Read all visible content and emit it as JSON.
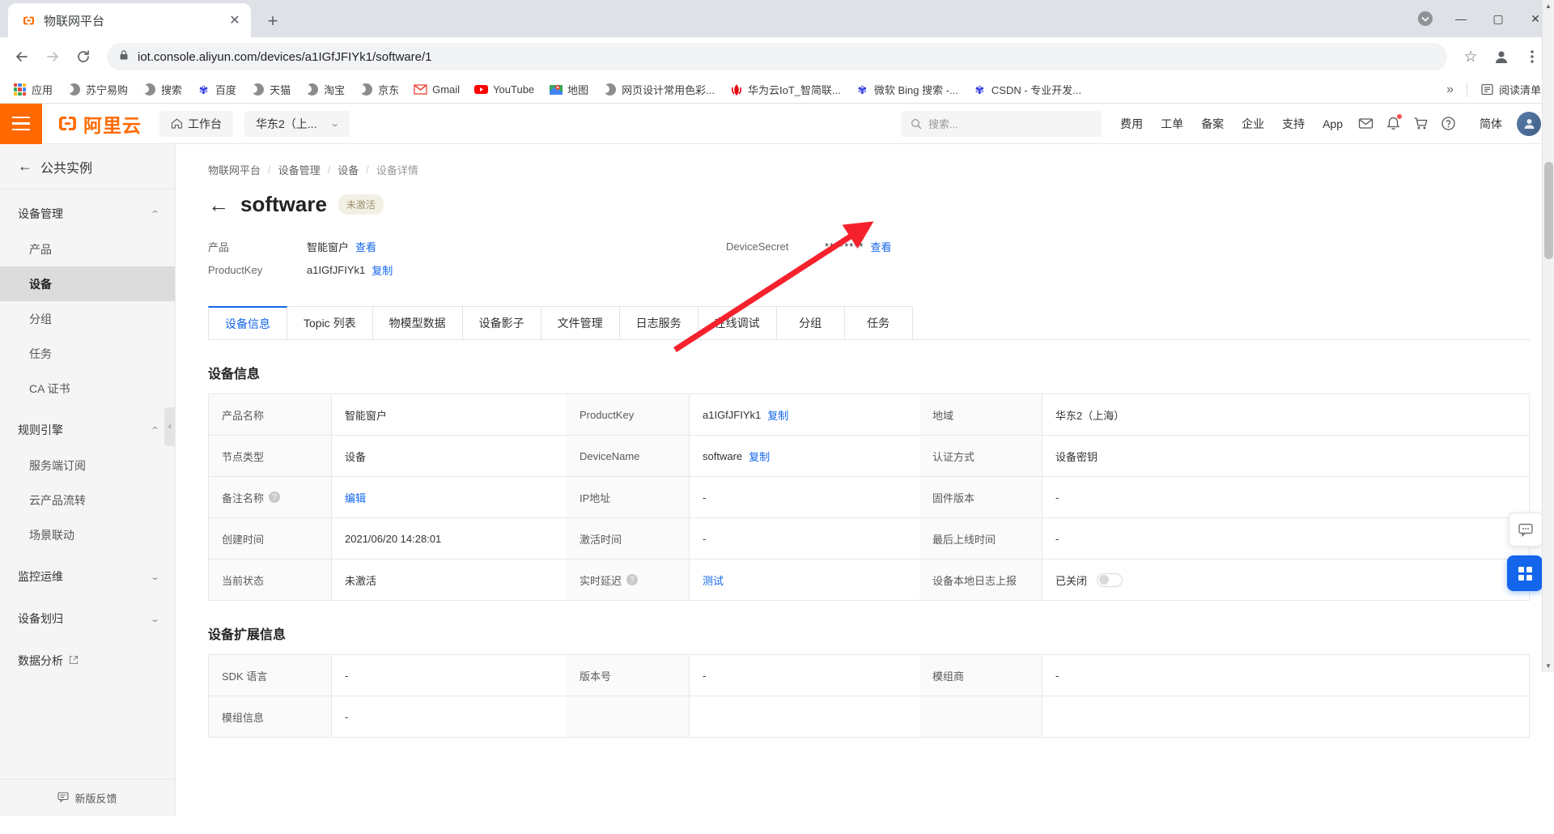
{
  "browser": {
    "tab": {
      "title": "物联网平台",
      "close": "✕"
    },
    "newtab_label": "+",
    "window": {
      "minimize": "—",
      "maximize": "▢",
      "close": "✕",
      "extra": "▾"
    },
    "nav": {
      "back": "←",
      "forward": "→",
      "reload": "⟳"
    },
    "omnibox": {
      "url": "iot.console.aliyun.com/devices/a1IGfJFIYk1/software/1",
      "lock": "lock-icon",
      "star": "☆"
    },
    "bookmarks": [
      {
        "label": "应用",
        "icon": "apps-grid-icon"
      },
      {
        "label": "苏宁易购",
        "icon": "globe-icon"
      },
      {
        "label": "搜索",
        "icon": "globe-icon"
      },
      {
        "label": "百度",
        "icon": "baidu-paw-icon"
      },
      {
        "label": "天猫",
        "icon": "globe-icon"
      },
      {
        "label": "淘宝",
        "icon": "globe-icon"
      },
      {
        "label": "京东",
        "icon": "globe-icon"
      },
      {
        "label": "Gmail",
        "icon": "gmail-icon"
      },
      {
        "label": "YouTube",
        "icon": "youtube-icon"
      },
      {
        "label": "地图",
        "icon": "maps-icon"
      },
      {
        "label": "网页设计常用色彩...",
        "icon": "globe-icon"
      },
      {
        "label": "华为云IoT_智简联...",
        "icon": "huawei-icon"
      },
      {
        "label": "微软 Bing 搜索 -...",
        "icon": "baidu-paw-icon"
      },
      {
        "label": "CSDN - 专业开发...",
        "icon": "baidu-paw-icon"
      }
    ],
    "bookmarks_overflow": "»",
    "reading_list": "阅读清单"
  },
  "ali_header": {
    "menu": "hamburger-icon",
    "logo_text": "阿里云",
    "workbench": "工作台",
    "region": "华东2（上...",
    "search_placeholder": "搜索...",
    "nav": [
      "费用",
      "工单",
      "备案",
      "企业",
      "支持",
      "App"
    ],
    "lang": "简体",
    "icons": [
      "mail-icon",
      "bell-icon",
      "cart-icon",
      "help-icon"
    ],
    "avatar": "user-avatar"
  },
  "sidebar": {
    "back_label": "公共实例",
    "groups": [
      {
        "label": "设备管理",
        "expanded": true,
        "items": [
          {
            "label": "产品",
            "active": false
          },
          {
            "label": "设备",
            "active": true
          },
          {
            "label": "分组",
            "active": false
          },
          {
            "label": "任务",
            "active": false
          },
          {
            "label": "CA 证书",
            "active": false
          }
        ]
      },
      {
        "label": "规则引擎",
        "expanded": true,
        "items": [
          {
            "label": "服务端订阅",
            "active": false
          },
          {
            "label": "云产品流转",
            "active": false
          },
          {
            "label": "场景联动",
            "active": false
          }
        ]
      },
      {
        "label": "监控运维",
        "expanded": false,
        "items": []
      },
      {
        "label": "设备划归",
        "expanded": false,
        "items": []
      }
    ],
    "external_item": {
      "label": "数据分析",
      "icon": "external-link-icon"
    },
    "footer": {
      "label": "新版反馈",
      "icon": "feedback-icon"
    },
    "collapse_handle": "‹"
  },
  "main": {
    "breadcrumb": [
      "物联网平台",
      "设备管理",
      "设备",
      "设备详情"
    ],
    "breadcrumb_sep": "/",
    "back_arrow": "←",
    "title": "software",
    "status_pill": "未激活",
    "meta": {
      "product_label": "产品",
      "product_value": "智能窗户",
      "product_link": "查看",
      "productkey_label": "ProductKey",
      "productkey_value": "a1IGfJFIYk1",
      "productkey_link": "复制",
      "devicesecret_label": "DeviceSecret",
      "devicesecret_value": "********",
      "devicesecret_link": "查看"
    },
    "tabs": [
      {
        "label": "设备信息",
        "active": true
      },
      {
        "label": "Topic 列表",
        "active": false
      },
      {
        "label": "物模型数据",
        "active": false
      },
      {
        "label": "设备影子",
        "active": false
      },
      {
        "label": "文件管理",
        "active": false
      },
      {
        "label": "日志服务",
        "active": false
      },
      {
        "label": "在线调试",
        "active": false
      },
      {
        "label": "分组",
        "active": false
      },
      {
        "label": "任务",
        "active": false
      }
    ],
    "section1_title": "设备信息",
    "device_info_rows": [
      [
        {
          "label": "产品名称",
          "value": "智能窗户",
          "kind": "text"
        },
        {
          "label": "ProductKey",
          "value": "a1IGfJFIYk1",
          "link": "复制",
          "kind": "link"
        },
        {
          "label": "地域",
          "value": "华东2（上海）",
          "kind": "text"
        }
      ],
      [
        {
          "label": "节点类型",
          "value": "设备",
          "kind": "text"
        },
        {
          "label": "DeviceName",
          "value": "software",
          "link": "复制",
          "kind": "link"
        },
        {
          "label": "认证方式",
          "value": "设备密钥",
          "kind": "text"
        }
      ],
      [
        {
          "label": "备注名称",
          "help": true,
          "value": "编辑",
          "kind": "linkonly"
        },
        {
          "label": "IP地址",
          "value": "-",
          "kind": "text"
        },
        {
          "label": "固件版本",
          "value": "-",
          "kind": "text"
        }
      ],
      [
        {
          "label": "创建时间",
          "value": "2021/06/20 14:28:01",
          "kind": "text"
        },
        {
          "label": "激活时间",
          "value": "-",
          "kind": "text"
        },
        {
          "label": "最后上线时间",
          "value": "-",
          "kind": "text"
        }
      ],
      [
        {
          "label": "当前状态",
          "value": "未激活",
          "kind": "text"
        },
        {
          "label": "实时延迟",
          "help": true,
          "value": "测试",
          "kind": "linkonly"
        },
        {
          "label": "设备本地日志上报",
          "value": "已关闭",
          "kind": "switch"
        }
      ]
    ],
    "section2_title": "设备扩展信息",
    "ext_info_rows": [
      [
        {
          "label": "SDK 语言",
          "value": "-"
        },
        {
          "label": "版本号",
          "value": "-"
        },
        {
          "label": "模组商",
          "value": "-"
        }
      ],
      [
        {
          "label": "模组信息",
          "value": "-"
        },
        {
          "label": "",
          "value": ""
        },
        {
          "label": "",
          "value": ""
        }
      ]
    ],
    "fab_chat": "chat-icon",
    "fab_apps": "apps-icon"
  },
  "colors": {
    "accent_orange": "#ff6a00",
    "link_blue": "#1366ec",
    "annotation_red": "#f5222d"
  }
}
